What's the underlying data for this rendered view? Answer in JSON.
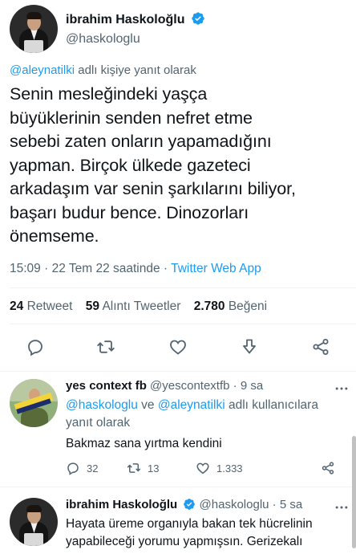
{
  "main_tweet": {
    "display_name": "ibrahim Haskoloğlu",
    "handle": "@haskologlu",
    "reply_context_mention": "@aleynatilki",
    "reply_context_suffix": " adlı kişiye yanıt olarak",
    "text_lines": [
      "Senin mesleğindeki yaşça",
      "büyüklerinin senden nefret etme",
      "sebebi zaten onların yapamadığını",
      "yapman. Birçok ülkede gazeteci",
      "arkadaşım var senin şarkılarını biliyor,",
      "başarı budur bence. Dinozorları",
      "önemseme."
    ],
    "time": "15:09",
    "date": "22 Tem 22 saatinde",
    "separator": "·",
    "source": "Twitter Web App",
    "stats": {
      "retweets_count": "24",
      "retweets_label": "Retweet",
      "quotes_count": "59",
      "quotes_label": "Alıntı Tweetler",
      "likes_count": "2.780",
      "likes_label": "Beğeni"
    },
    "actions": [
      "reply-icon",
      "retweet-icon",
      "like-icon",
      "bookmark-icon",
      "share-icon"
    ]
  },
  "replies": [
    {
      "display_name": "yes context fb",
      "handle": "@yescontextfb",
      "separator": "·",
      "time": "9 sa",
      "context_line1": "@haskologlu ve @aleynatilki adlı kullanıcılara",
      "context_mention_a": "@haskologlu",
      "context_mid": " ve ",
      "context_mention_b": "@aleynatilki",
      "context_suffix": " adlı kullanıcılara",
      "context_line2": "yanıt olarak",
      "text": "Bakmaz sana yırtma kendini",
      "reply_count": "32",
      "retweet_count": "13",
      "like_count": "1.333"
    },
    {
      "display_name": "ibrahim Haskoloğlu",
      "handle": "@haskologlu",
      "separator": "·",
      "time": "5 sa",
      "text_lines": [
        "Hayata üreme organıyla bakan tek hücrelinin",
        "yapabileceği yorumu yapmışsın. Gerizekalı"
      ]
    }
  ],
  "colors": {
    "accent": "#1d9bf0",
    "secondary_text": "#536471",
    "primary_text": "#0f1419",
    "divider": "#eff3f4"
  }
}
